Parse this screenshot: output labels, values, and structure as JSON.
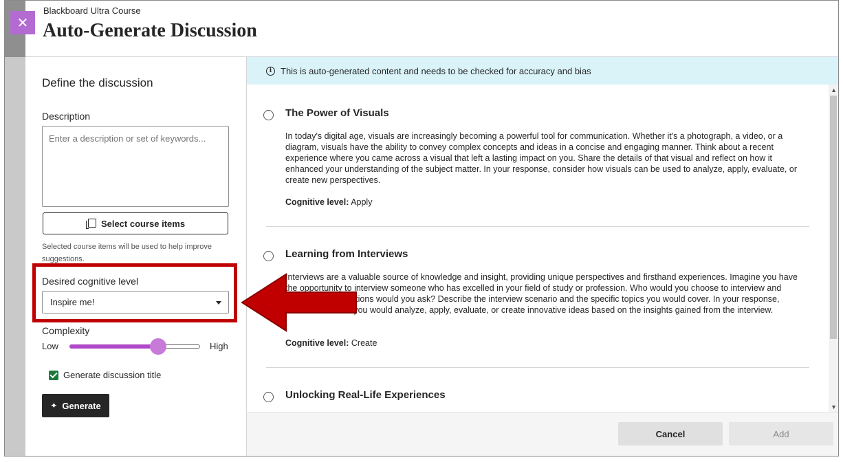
{
  "colors": {
    "accent_purple": "#b36bd1",
    "slider_fill": "#b048c9",
    "banner_bg": "#d9f3f9",
    "highlight_red": "#c00000",
    "checkbox_green": "#1b7a3a"
  },
  "header": {
    "course_name": "Blackboard Ultra Course",
    "title": "Auto-Generate Discussion",
    "close_icon": "close-icon",
    "close_glyph": "✕"
  },
  "left": {
    "section_title": "Define the discussion",
    "description_label": "Description",
    "description_placeholder": "Enter a description or set of keywords...",
    "select_items_label": "Select course items",
    "helper_text": "Selected course items will be used to help improve suggestions.",
    "cognitive_label": "Desired cognitive level",
    "cognitive_value": "Inspire me!",
    "complexity_label": "Complexity",
    "complexity_low": "Low",
    "complexity_high": "High",
    "complexity_level": 0.68,
    "generate_title_label": "Generate discussion title",
    "generate_title_checked": true,
    "generate_label": "Generate",
    "sparkle_glyph": "✦"
  },
  "right": {
    "banner_text": "This is auto-generated content and needs to be checked for accuracy and bias",
    "info_glyph": "i",
    "level_prefix": "Cognitive level:",
    "items": [
      {
        "title": "The Power of Visuals",
        "body": "In today's digital age, visuals are increasingly becoming a powerful tool for communication. Whether it's a photograph, a video, or a diagram, visuals have the ability to convey complex concepts and ideas in a concise and engaging manner. Think about a recent experience where you came across a visual that left a lasting impact on you. Share the details of that visual and reflect on how it enhanced your understanding of the subject matter. In your response, consider how visuals can be used to analyze, apply, evaluate, or create new perspectives.",
        "level": "Apply"
      },
      {
        "title": "Learning from Interviews",
        "body": "Interviews are a valuable source of knowledge and insight, providing unique perspectives and firsthand experiences. Imagine you have the opportunity to interview someone who has excelled in your field of study or profession. Who would you choose to interview and what burning questions would you ask? Describe the interview scenario and the specific topics you would cover. In your response, demonstrate how you would analyze, apply, evaluate, or create innovative ideas based on the insights gained from the interview.",
        "level": "Create"
      },
      {
        "title": "Unlocking Real-Life Experiences"
      }
    ],
    "scroll_up_glyph": "▲",
    "scroll_down_glyph": "▼",
    "cancel_label": "Cancel",
    "add_label": "Add"
  }
}
